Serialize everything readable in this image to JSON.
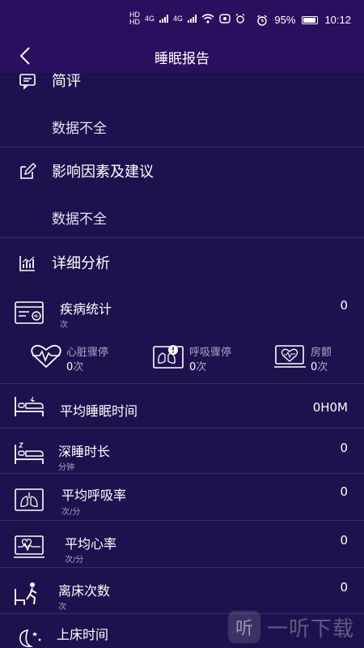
{
  "status_bar": {
    "network_labels": [
      "HD",
      "HD",
      "4G",
      "4G"
    ],
    "battery": "95%",
    "time": "10:12"
  },
  "header": {
    "title": "睡眠报告"
  },
  "summary": {
    "title": "简评",
    "body": "数据不全"
  },
  "factors": {
    "title": "影响因素及建议",
    "body": "数据不全"
  },
  "analysis": {
    "title": "详细分析",
    "disease": {
      "label": "疾病统计",
      "unit": "次",
      "value": "0",
      "items": [
        {
          "label": "心脏骤停",
          "value": "0",
          "unit": "次"
        },
        {
          "label": "呼吸骤停",
          "value": "0",
          "unit": "次"
        },
        {
          "label": "房颤",
          "value": "0",
          "unit": "次"
        }
      ]
    },
    "metrics": [
      {
        "label": "平均睡眠时间",
        "unit": "",
        "value": "0H0M"
      },
      {
        "label": "深睡时长",
        "unit": "分钟",
        "value": "0"
      },
      {
        "label": "平均呼吸率",
        "unit": "次/分",
        "value": "0"
      },
      {
        "label": "平均心率",
        "unit": "次/分",
        "value": "0"
      },
      {
        "label": "离床次数",
        "unit": "次",
        "value": "0"
      },
      {
        "label": "上床时间",
        "unit": "",
        "value": ""
      }
    ]
  },
  "watermark": {
    "logo": "听",
    "text": "一听下载"
  }
}
